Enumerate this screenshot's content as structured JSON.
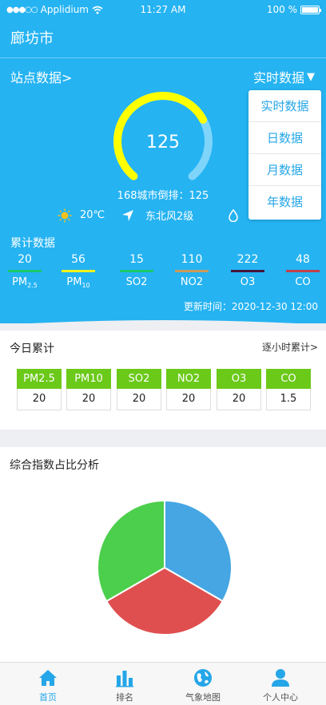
{
  "status_bar": {
    "carrier": "Applidium",
    "time": "11:27 AM",
    "battery": "100 %"
  },
  "header": {
    "city": "廊坊市"
  },
  "station": {
    "label": "站点数据",
    "chevron": ">"
  },
  "realtime": {
    "label": "实时数据",
    "caret": "▼"
  },
  "gauge": {
    "value": "125",
    "fraction": 0.72
  },
  "rank": {
    "text": "168城市倒排：125"
  },
  "weather": {
    "temp": "20℃",
    "wind": "东北风2级"
  },
  "dropdown": {
    "items": [
      "实时数据",
      "日数据",
      "月数据",
      "年数据"
    ]
  },
  "cumulative": {
    "title": "累计数据",
    "pollutants": [
      {
        "value": "20",
        "name": "PM",
        "sub": "2.5",
        "color": "#1cc96a"
      },
      {
        "value": "56",
        "name": "PM",
        "sub": "10",
        "color": "#f3f11b"
      },
      {
        "value": "15",
        "name": "SO2",
        "sub": "",
        "color": "#1cc96a"
      },
      {
        "value": "110",
        "name": "NO2",
        "sub": "",
        "color": "#c99b5a"
      },
      {
        "value": "222",
        "name": "O3",
        "sub": "",
        "color": "#46163c"
      },
      {
        "value": "48",
        "name": "CO",
        "sub": "",
        "color": "#c0404a"
      }
    ]
  },
  "update": {
    "text": "更新时间：2020-12-30 12:00"
  },
  "today": {
    "title": "今日累计",
    "more": "逐小时累计>",
    "items": [
      {
        "name": "PM2.5",
        "value": "20"
      },
      {
        "name": "PM10",
        "value": "20"
      },
      {
        "name": "SO2",
        "value": "20"
      },
      {
        "name": "NO2",
        "value": "20"
      },
      {
        "name": "O3",
        "value": "20"
      },
      {
        "name": "CO",
        "value": "1.5"
      }
    ]
  },
  "analysis": {
    "title": "综合指数占比分析",
    "slices": [
      {
        "fraction": 0.3333,
        "color": "#45a6e3"
      },
      {
        "fraction": 0.3333,
        "color": "#e04f4f"
      },
      {
        "fraction": 0.3334,
        "color": "#4ccf4c"
      }
    ]
  },
  "tabs": [
    {
      "label": "首页",
      "icon": "home-icon"
    },
    {
      "label": "排名",
      "icon": "bar-chart-icon"
    },
    {
      "label": "气象地图",
      "icon": "globe-icon"
    },
    {
      "label": "个人中心",
      "icon": "user-icon"
    }
  ],
  "colors": {
    "primary": "#25b3f2",
    "accent": "#25a6e8",
    "green": "#6bc919",
    "gauge_fill": "#ffff00"
  }
}
